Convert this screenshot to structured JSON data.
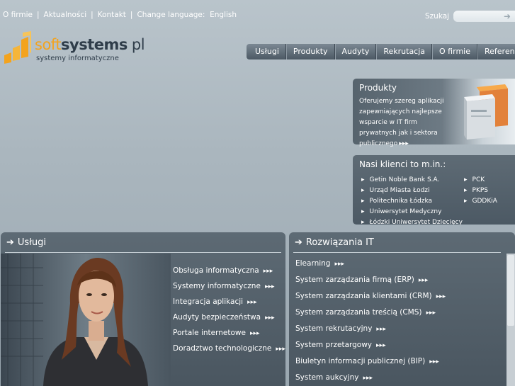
{
  "topnav": {
    "items": [
      "O firmie",
      "Aktualności",
      "Kontakt"
    ],
    "change_language_label": "Change language:",
    "language": "English",
    "separator": "|"
  },
  "search": {
    "label": "Szukaj",
    "value": "",
    "icon": "arrow-right-icon"
  },
  "logo": {
    "soft": "soft",
    "systems": "systems",
    "pl": "pl",
    "tagline": "systemy informatyczne"
  },
  "mainmenu": [
    "Usługi",
    "Produkty",
    "Audyty",
    "Rekrutacja",
    "O firmie",
    "Referencje"
  ],
  "products_box": {
    "title": "Produkty",
    "description": "Oferujemy szereg aplikacji zapewniających najlepsze wsparcie w IT firm prywatnych jak i sektora publicznego",
    "arrows": "▸▸▸"
  },
  "clients_box": {
    "title": "Nasi klienci to m.in.:",
    "col1": [
      "Getin Noble Bank S.A.",
      "Urząd Miasta Łodzi",
      "Politechnika Łódzka",
      "Uniwersytet Medyczny",
      "Łódzki Uniwersytet Dziecięcy"
    ],
    "col2": [
      "PCK",
      "PKPS",
      "GDDKiA"
    ]
  },
  "uslugi_panel": {
    "title": "Usługi",
    "items": [
      "Obsługa informatyczna",
      "Systemy informatyczne",
      "Integracja aplikacji",
      "Audyty bezpieczeństwa",
      "Portale internetowe",
      "Doradztwo technologiczne"
    ]
  },
  "it_panel": {
    "title": "Rozwiązania IT",
    "items": [
      "Elearning",
      "System zarządzania firmą (ERP)",
      "System zarządzania klientami (CRM)",
      "System zarządzania treścią (CMS)",
      "System rekrutacyjny",
      "System przetargowy",
      "Biuletyn informacji publicznej (BIP)",
      "System aukcyjny"
    ]
  },
  "arrows": "▸▸▸",
  "colors": {
    "accent": "#f3a31e",
    "panel": "#56636d",
    "background": "#aab6be"
  }
}
